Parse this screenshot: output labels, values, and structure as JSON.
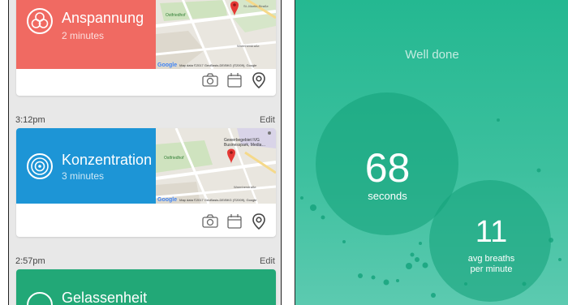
{
  "left_screen": {
    "sessions": [
      {
        "name": "Anspannung",
        "duration": "2 minutes",
        "color": "#f06a62",
        "map_labels": [
          "Ostfriedhof",
          "St.-Martin-Straße",
          "Warmherstraße"
        ],
        "map_credit_brand": "Google",
        "map_credit": "Map data ©2017 GeoBasis-DE/BKG (©2009), Google"
      },
      {
        "time": "3:12pm",
        "edit_label": "Edit",
        "name": "Konzentration",
        "duration": "3 minutes",
        "color": "#1d95d6",
        "map_labels": [
          "Gewerbegebiet IVG Businesspark, Media…",
          "Ostfriedhof",
          "Warmherstraße"
        ],
        "map_credit_brand": "Google",
        "map_credit": "Map data ©2017 GeoBasis-DE/BKG (©2009), Google"
      },
      {
        "time": "2:57pm",
        "edit_label": "Edit",
        "name": "Gelassenheit",
        "color": "#22a877"
      }
    ],
    "action_icons": [
      "camera-icon",
      "calendar-icon",
      "location-pin-icon"
    ]
  },
  "right_screen": {
    "title": "Well done",
    "seconds": {
      "value": "68",
      "label": "seconds"
    },
    "breaths": {
      "value": "11",
      "label_line1": "avg breaths",
      "label_line2": "per minute"
    },
    "background_color": "#2fbc96"
  }
}
